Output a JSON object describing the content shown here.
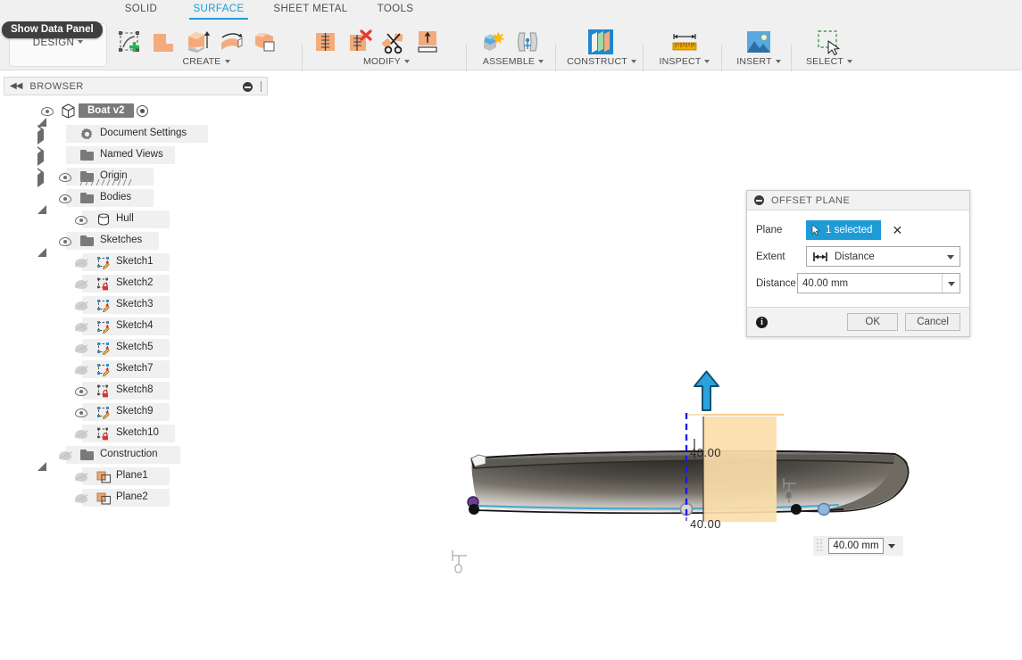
{
  "app": {
    "data_panel_tooltip": "Show Data Panel",
    "workspace_label": "DESIGN"
  },
  "tabs": [
    {
      "label": "SOLID",
      "active": false
    },
    {
      "label": "SURFACE",
      "active": true
    },
    {
      "label": "SHEET METAL",
      "active": false
    },
    {
      "label": "TOOLS",
      "active": false
    }
  ],
  "ribbon": {
    "groups": [
      {
        "label": "CREATE",
        "icons": [
          "create-sketch-icon",
          "extrude-surface-icon",
          "extrude-icon",
          "revolve-icon",
          "patch-icon"
        ]
      },
      {
        "label": "MODIFY",
        "icons": [
          "fillet-icon",
          "delete-face-icon",
          "trim-icon",
          "extend-icon"
        ]
      },
      {
        "label": "ASSEMBLE",
        "icons": [
          "new-component-icon",
          "joint-icon"
        ]
      },
      {
        "label": "CONSTRUCT",
        "icons": [
          "offset-plane-icon"
        ]
      },
      {
        "label": "INSPECT",
        "icons": [
          "measure-icon"
        ]
      },
      {
        "label": "INSERT",
        "icons": [
          "insert-image-icon"
        ]
      },
      {
        "label": "SELECT",
        "icons": [
          "select-window-icon"
        ]
      }
    ]
  },
  "browser": {
    "title": "BROWSER",
    "root": {
      "label": "Boat v2"
    },
    "items": [
      {
        "label": "Document Settings",
        "indent": 1,
        "icon": "gear-icon",
        "arrow": "closed",
        "eye": "none"
      },
      {
        "label": "Named Views",
        "indent": 1,
        "icon": "folder-icon",
        "arrow": "closed",
        "eye": "none"
      },
      {
        "label": "Origin",
        "indent": 1,
        "icon": "folder-icon",
        "arrow": "closed",
        "eye": "on"
      },
      {
        "label": "Bodies",
        "indent": 1,
        "icon": "folder-icon",
        "arrow": "open",
        "eye": "on"
      },
      {
        "label": "Hull",
        "indent": 2,
        "icon": "body-icon",
        "arrow": "none",
        "eye": "on"
      },
      {
        "label": "Sketches",
        "indent": 1,
        "icon": "folder-icon",
        "arrow": "open",
        "eye": "on"
      },
      {
        "label": "Sketch1",
        "indent": 2,
        "icon": "sketch-edit-icon",
        "arrow": "none",
        "eye": "off"
      },
      {
        "label": "Sketch2",
        "indent": 2,
        "icon": "sketch-lock-icon",
        "arrow": "none",
        "eye": "off"
      },
      {
        "label": "Sketch3",
        "indent": 2,
        "icon": "sketch-edit-icon",
        "arrow": "none",
        "eye": "off"
      },
      {
        "label": "Sketch4",
        "indent": 2,
        "icon": "sketch-edit-icon",
        "arrow": "none",
        "eye": "off"
      },
      {
        "label": "Sketch5",
        "indent": 2,
        "icon": "sketch-edit-icon",
        "arrow": "none",
        "eye": "off"
      },
      {
        "label": "Sketch7",
        "indent": 2,
        "icon": "sketch-edit-icon",
        "arrow": "none",
        "eye": "off"
      },
      {
        "label": "Sketch8",
        "indent": 2,
        "icon": "sketch-lock-icon",
        "arrow": "none",
        "eye": "on"
      },
      {
        "label": "Sketch9",
        "indent": 2,
        "icon": "sketch-edit-icon",
        "arrow": "none",
        "eye": "on"
      },
      {
        "label": "Sketch10",
        "indent": 2,
        "icon": "sketch-lock-icon",
        "arrow": "none",
        "eye": "off"
      },
      {
        "label": "Construction",
        "indent": 1,
        "icon": "folder-icon",
        "arrow": "open",
        "eye": "off"
      },
      {
        "label": "Plane1",
        "indent": 2,
        "icon": "plane-icon",
        "arrow": "none",
        "eye": "off"
      },
      {
        "label": "Plane2",
        "indent": 2,
        "icon": "plane-icon",
        "arrow": "none",
        "eye": "off"
      }
    ]
  },
  "dialog": {
    "title": "OFFSET PLANE",
    "fields": {
      "plane_label": "Plane",
      "plane_value": "1 selected",
      "extent_label": "Extent",
      "extent_value": "Distance",
      "distance_label": "Distance",
      "distance_value": "40.00 mm"
    },
    "ok_label": "OK",
    "cancel_label": "Cancel"
  },
  "canvas": {
    "dimension_text": "40.00",
    "inline_value": "40.00 mm",
    "model_name": "Hull"
  },
  "colors": {
    "accent": "#1e9bd7",
    "ribbon_bg": "#f0f0f0",
    "plane_preview": "#fbddaa",
    "arrow_blue": "#2196d4",
    "icon_orange": "#f0a875",
    "hull_dark": "#6b665c"
  }
}
